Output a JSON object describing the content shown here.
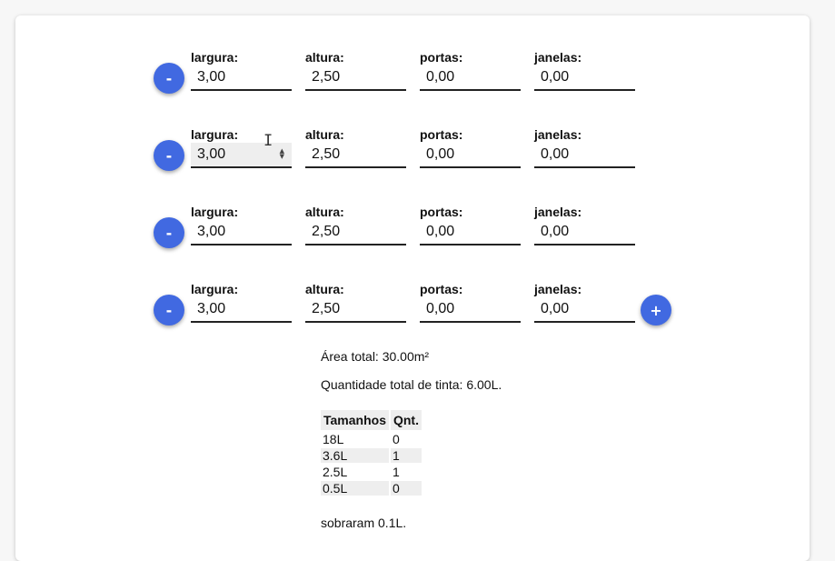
{
  "walls": [
    {
      "largura_label": "largura:",
      "largura": "3,00",
      "altura_label": "altura:",
      "altura": "2,50",
      "portas_label": "portas:",
      "portas": "0,00",
      "janelas_label": "janelas:",
      "janelas": "0,00",
      "remove_label": "-"
    },
    {
      "largura_label": "largura:",
      "largura": "3,00",
      "altura_label": "altura:",
      "altura": "2,50",
      "portas_label": "portas:",
      "portas": "0,00",
      "janelas_label": "janelas:",
      "janelas": "0,00",
      "remove_label": "-"
    },
    {
      "largura_label": "largura:",
      "largura": "3,00",
      "altura_label": "altura:",
      "altura": "2,50",
      "portas_label": "portas:",
      "portas": "0,00",
      "janelas_label": "janelas:",
      "janelas": "0,00",
      "remove_label": "-"
    },
    {
      "largura_label": "largura:",
      "largura": "3,00",
      "altura_label": "altura:",
      "altura": "2,50",
      "portas_label": "portas:",
      "portas": "0,00",
      "janelas_label": "janelas:",
      "janelas": "0,00",
      "remove_label": "-"
    }
  ],
  "add_label": "+",
  "spinner_glyph": "⌃⌄",
  "cursor_glyph": "I",
  "results": {
    "area_total": "Área total: 30.00m²",
    "tinta_total": "Quantidade total de tinta: 6.00L.",
    "table": {
      "headers": [
        "Tamanhos",
        "Qnt."
      ],
      "rows": [
        [
          "18L",
          "0"
        ],
        [
          "3.6L",
          "1"
        ],
        [
          "2.5L",
          "1"
        ],
        [
          "0.5L",
          "0"
        ]
      ]
    },
    "sobra": "sobraram 0.1L."
  },
  "colors": {
    "accent": "#4169e1",
    "card": "#ffffff",
    "background": "#f7f7f7"
  }
}
